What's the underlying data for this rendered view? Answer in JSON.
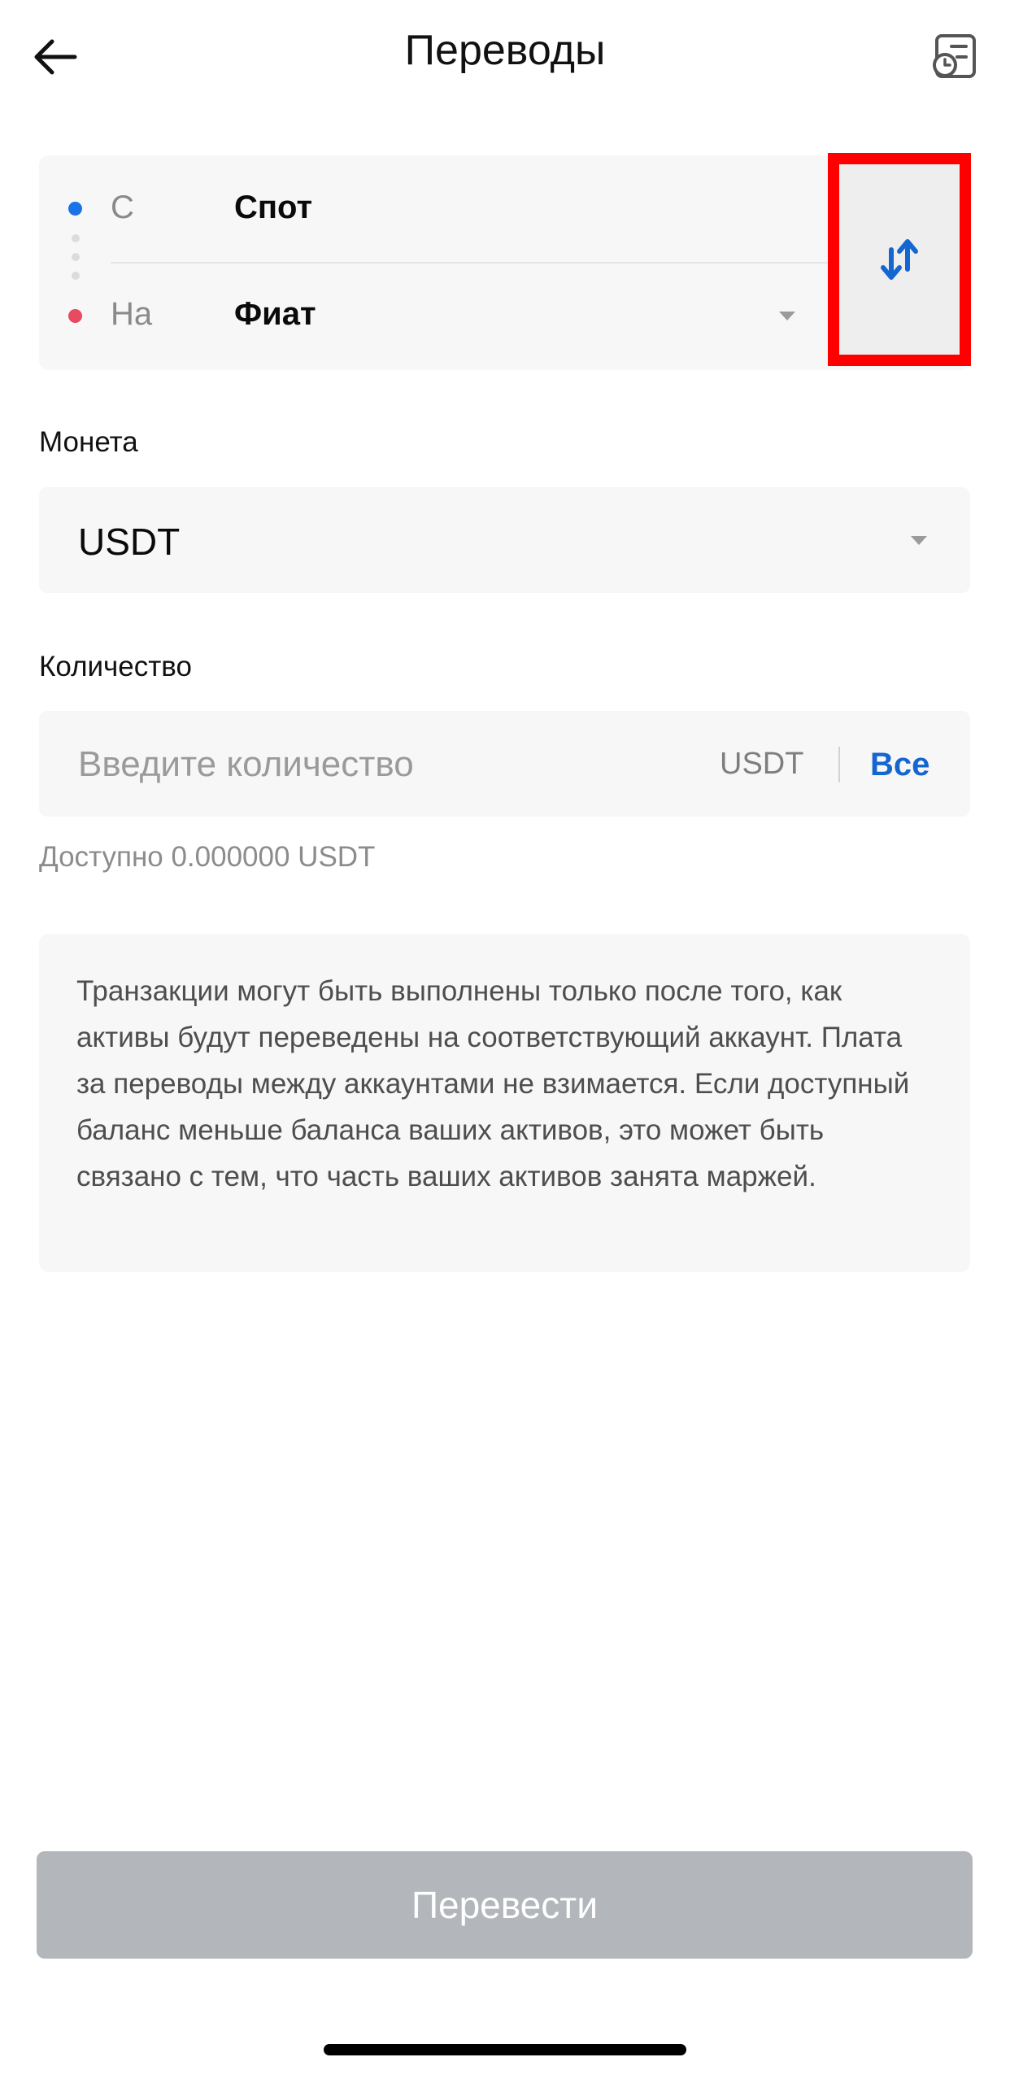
{
  "header": {
    "title": "Переводы",
    "back_icon": "arrow-left-icon",
    "history_icon": "transfer-history-icon"
  },
  "transfer": {
    "from_label": "С",
    "from_value": "Спот",
    "to_label": "На",
    "to_value": "Фиат",
    "swap_icon": "swap-arrows-icon",
    "from_dot_color": "#1a73e8",
    "to_dot_color": "#e84a5f",
    "highlight_color": "#ff0000"
  },
  "coin": {
    "label": "Монета",
    "value": "USDT"
  },
  "amount": {
    "label": "Количество",
    "placeholder": "Введите количество",
    "value": "",
    "unit": "USDT",
    "all_label": "Все",
    "available": "Доступно 0.000000 USDT"
  },
  "info": {
    "text": "Транзакции могут быть выполнены только после того, как активы будут переведены на соответствующий аккаунт. Плата за переводы между аккаунтами не взимается. Если доступный баланс меньше баланса ваших активов, это может быть связано с тем, что часть ваших активов занята маржей."
  },
  "submit": {
    "label": "Перевести",
    "enabled": false
  },
  "colors": {
    "accent": "#1466d0",
    "disabled_button": "#b3b6ba",
    "field_background": "#f7f7f7"
  }
}
